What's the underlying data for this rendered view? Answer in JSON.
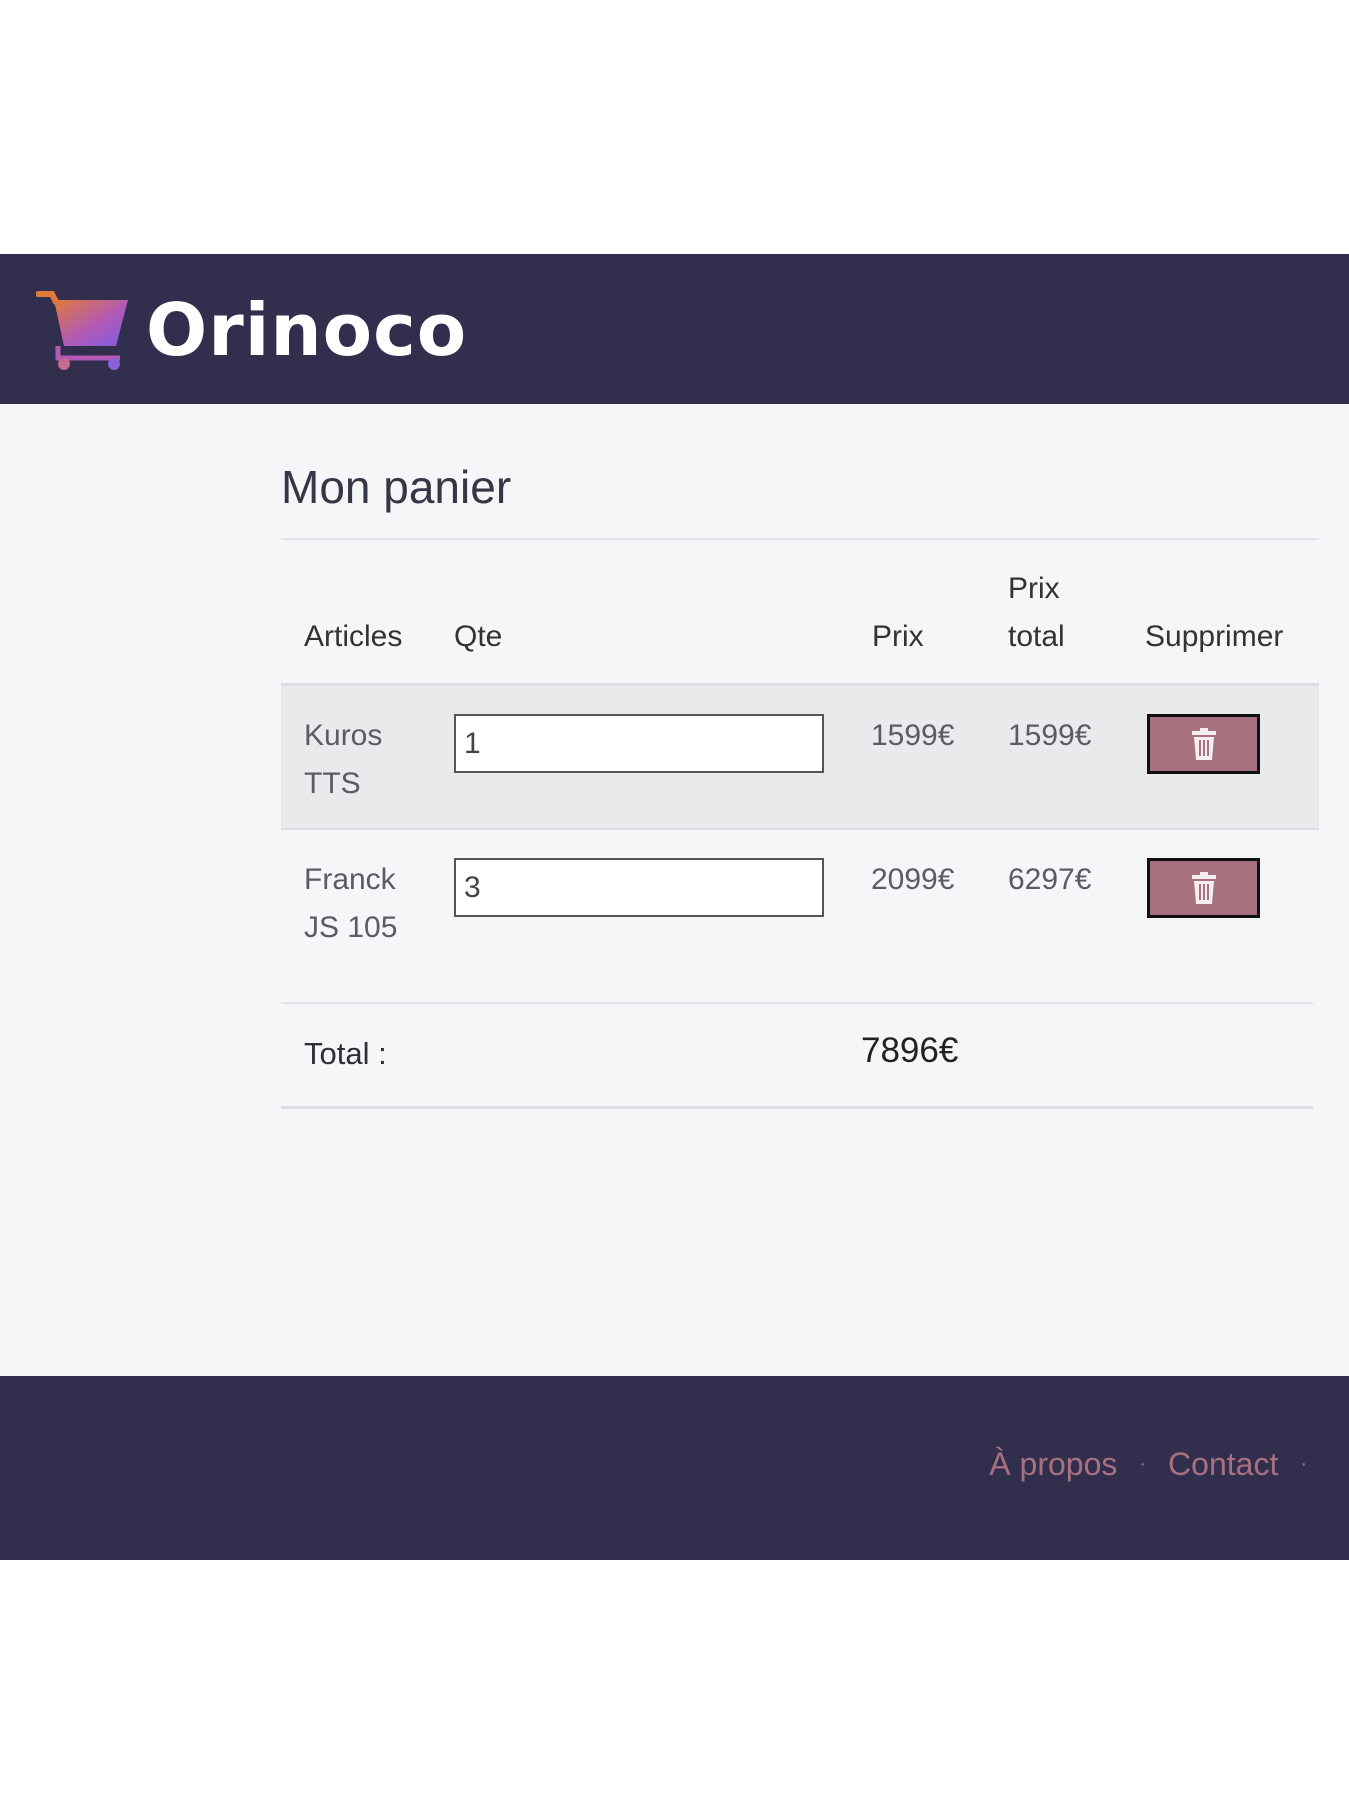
{
  "header": {
    "brand_name": "Orinoco",
    "logo_icon": "shopping-cart-icon"
  },
  "cart": {
    "title": "Mon panier",
    "columns": {
      "articles": "Articles",
      "qty": "Qte",
      "price": "Prix",
      "total_price_line1": "Prix",
      "total_price_line2": "total",
      "delete": "Supprimer"
    },
    "items": [
      {
        "name_line1": "Kuros",
        "name_line2": "TTS",
        "qty": "1",
        "price": "1599€",
        "total": "1599€",
        "delete_icon": "trash-icon"
      },
      {
        "name_line1": "Franck",
        "name_line2": "JS 105",
        "qty": "3",
        "price": "2099€",
        "total": "6297€",
        "delete_icon": "trash-icon"
      }
    ],
    "total_label": "Total :",
    "total_value": "7896€"
  },
  "footer": {
    "links": [
      "À propos",
      "Contact"
    ],
    "separator": "·"
  },
  "colors": {
    "header_bg": "#312e4e",
    "accent": "#a8717f",
    "page_bg": "#f5f6f8"
  }
}
